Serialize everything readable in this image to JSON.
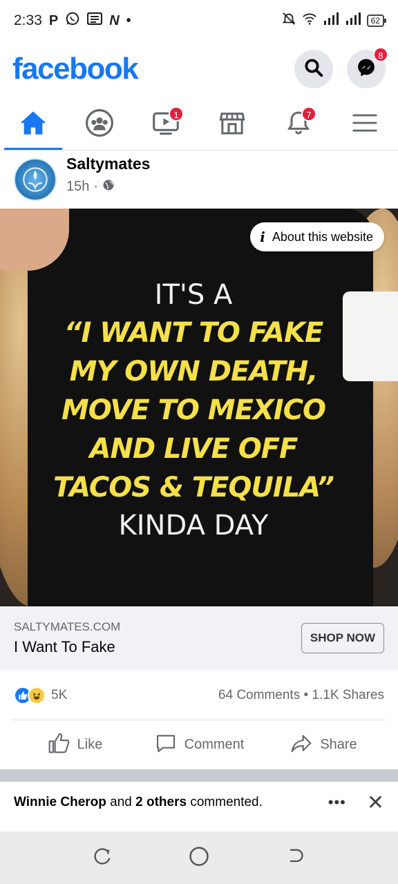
{
  "status_bar": {
    "time": "2:33",
    "app_icons": [
      "P",
      "whatsapp-icon",
      "news-icon",
      "N",
      "•"
    ],
    "battery": "62"
  },
  "header": {
    "logo": "facebook",
    "messenger_badge": "8"
  },
  "nav": {
    "watch_badge": "1",
    "notifications_badge": "7"
  },
  "post": {
    "page_name": "Saltymates",
    "time": "15h",
    "dot": "·",
    "about_label": "About this website",
    "shirt_lines": {
      "l1": "IT'S A",
      "l2": "“I WANT TO FAKE",
      "l3": "MY OWN DEATH,",
      "l4": "MOVE TO MEXICO",
      "l5": "AND LIVE OFF",
      "l6": "TACOS & TEQUILA”",
      "l7": "KINDA DAY"
    },
    "link_domain": "SALTYMATES.COM",
    "link_title": "I Want To Fake",
    "cta": "SHOP NOW",
    "reactions_count": "5K",
    "comments": "64 Comments",
    "sep": "•",
    "shares": "1.1K Shares",
    "actions": {
      "like": "Like",
      "comment": "Comment",
      "share": "Share"
    }
  },
  "notice": {
    "name": "Winnie Cherop",
    "and": " and ",
    "others": "2 others",
    "rest": " commented.",
    "more": "•••",
    "close": "✕"
  },
  "colors": {
    "brand": "#1877f2",
    "badge": "#e41e3f",
    "shirt_yellow": "#f5e04a"
  }
}
